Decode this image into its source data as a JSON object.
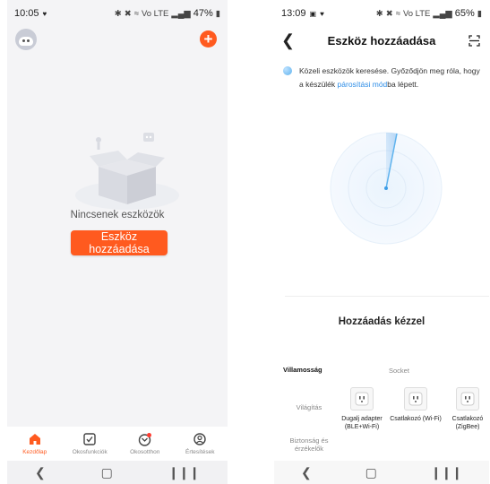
{
  "left": {
    "status": {
      "time": "10:05",
      "signal": "Vo LTE",
      "battery": "47%"
    },
    "empty_text": "Nincsenek eszközök",
    "add_button": "Eszköz hozzáadása",
    "nav": [
      {
        "label": "Kezdőlap",
        "icon": "home-icon",
        "active": true
      },
      {
        "label": "Okosfunkciók",
        "icon": "checkbox-icon"
      },
      {
        "label": "Okosotthon",
        "icon": "smart-home-icon"
      },
      {
        "label": "Értesítések",
        "icon": "profile-icon"
      }
    ]
  },
  "right": {
    "status": {
      "time": "13:09",
      "signal": "Vo LTE",
      "battery": "65%"
    },
    "title": "Eszköz hozzáadása",
    "info_pre": "Közeli eszközök keresése. Győződjön meg róla, hogy a készülék ",
    "info_link": "párosítási mód",
    "info_post": "ba lépett.",
    "manual_title": "Hozzáadás kézzel",
    "categories": [
      "Villamosság",
      "Világítás",
      "Biztonság és érzékelők"
    ],
    "socket_header": "Socket",
    "devices": [
      {
        "name": "Dugalj adapter (BLE+Wi-Fi)"
      },
      {
        "name": "Csatlakozó (Wi-Fi)"
      },
      {
        "name": "Csatlakozó (ZigBee)"
      }
    ]
  },
  "colors": {
    "accent": "#ff5a1f",
    "link": "#2f8ee7",
    "radar": "#5fb3ee"
  }
}
